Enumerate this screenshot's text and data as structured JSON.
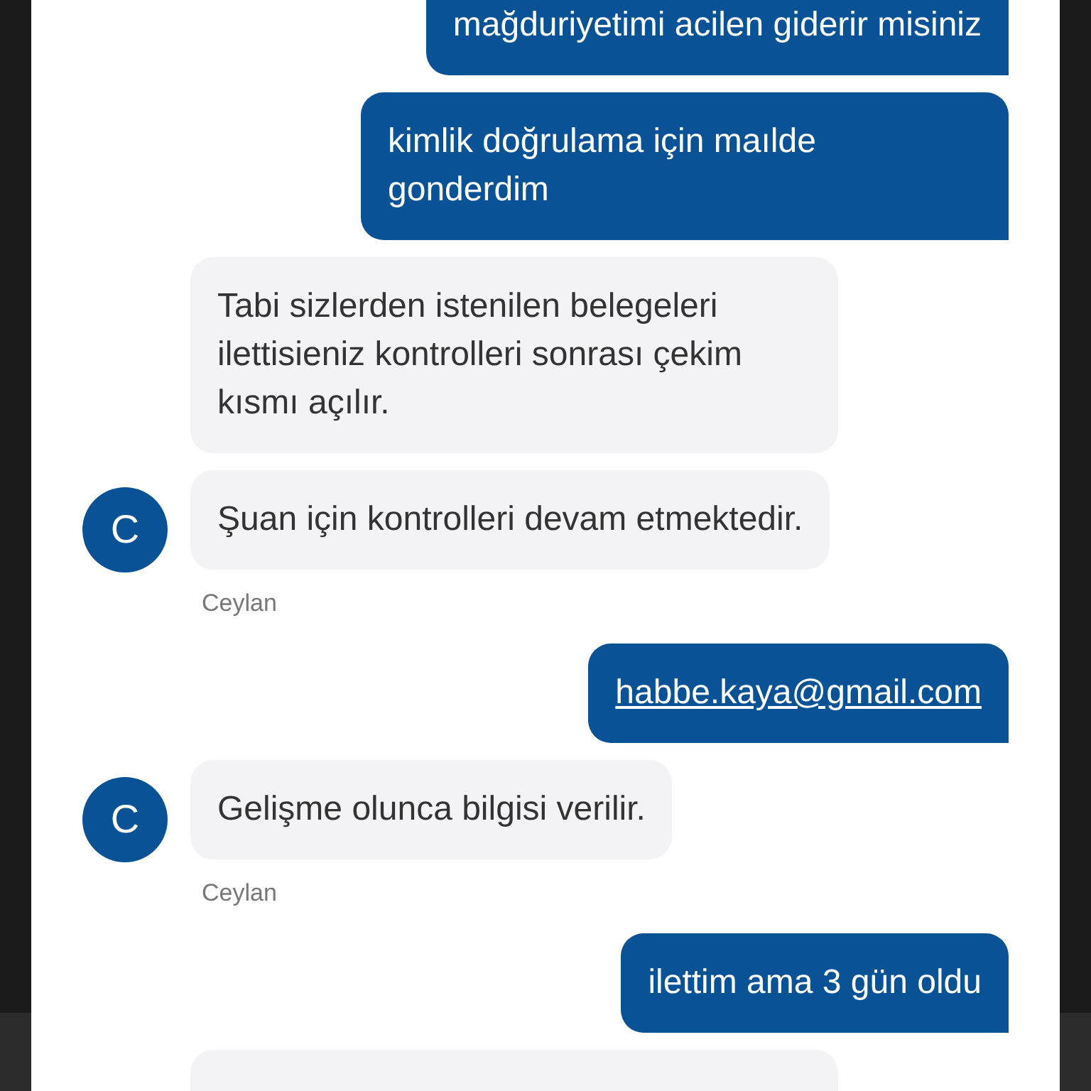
{
  "messages": [
    {
      "kind": "user",
      "text": "mağduriyetimi acilen giderir misiniz"
    },
    {
      "kind": "user",
      "text": "kimlik doğrulama için maılde gonderdim"
    },
    {
      "kind": "agent",
      "text": "Tabi sizlerden istenilen belegeleri ilettisieniz kontrolleri sonrası çekim kısmı açılır."
    },
    {
      "kind": "agent",
      "text": "Şuan için kontrolleri devam etmektedir.",
      "avatar": "C",
      "sender": "Ceylan"
    },
    {
      "kind": "user",
      "text": "habbe.kaya@gmail.com",
      "link": true
    },
    {
      "kind": "agent",
      "text": "Gelişme olunca bilgisi verilir.",
      "avatar": "C",
      "sender": "Ceylan"
    },
    {
      "kind": "user",
      "text": "ilettim ama 3 gün oldu"
    },
    {
      "kind": "agent"
    }
  ]
}
